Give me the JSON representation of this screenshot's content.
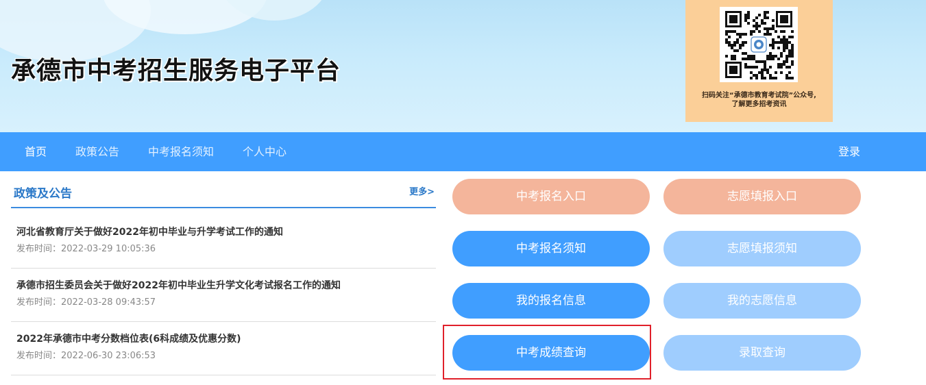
{
  "header": {
    "site_title": "承德市中考招生服务电子平台",
    "qr_caption_line1": "扫码关注“承德市教育考试院”公众号,",
    "qr_caption_line2": "了解更多招考资讯"
  },
  "nav": {
    "items": [
      {
        "label": "首页",
        "active": true
      },
      {
        "label": "政策公告",
        "active": false
      },
      {
        "label": "中考报名须知",
        "active": false
      },
      {
        "label": "个人中心",
        "active": false
      }
    ],
    "login_label": "登录"
  },
  "news": {
    "title": "政策及公告",
    "more_label": "更多>",
    "items": [
      {
        "title": "河北省教育厅关于做好2022年初中毕业与升学考试工作的通知",
        "time": "发布时间：2022-03-29 10:05:36"
      },
      {
        "title": "承德市招生委员会关于做好2022年初中毕业生升学文化考试报名工作的通知",
        "time": "发布时间：2022-03-28 09:43:57"
      },
      {
        "title": "2022年承德市中考分数档位表(6科成绩及优惠分数)",
        "time": "发布时间：2022-06-30 23:06:53"
      }
    ]
  },
  "actions": {
    "registration_entry": "中考报名入口",
    "preference_entry": "志愿填报入口",
    "registration_notice": "中考报名须知",
    "preference_notice": "志愿填报须知",
    "my_registration": "我的报名信息",
    "my_preference": "我的志愿信息",
    "score_query": "中考成绩查询",
    "admission_query": "录取查询"
  },
  "colors": {
    "nav_blue": "#409eff",
    "peach": "#f4b59b",
    "light_blue": "#9fcdfe",
    "highlight_red": "#e0202a"
  }
}
